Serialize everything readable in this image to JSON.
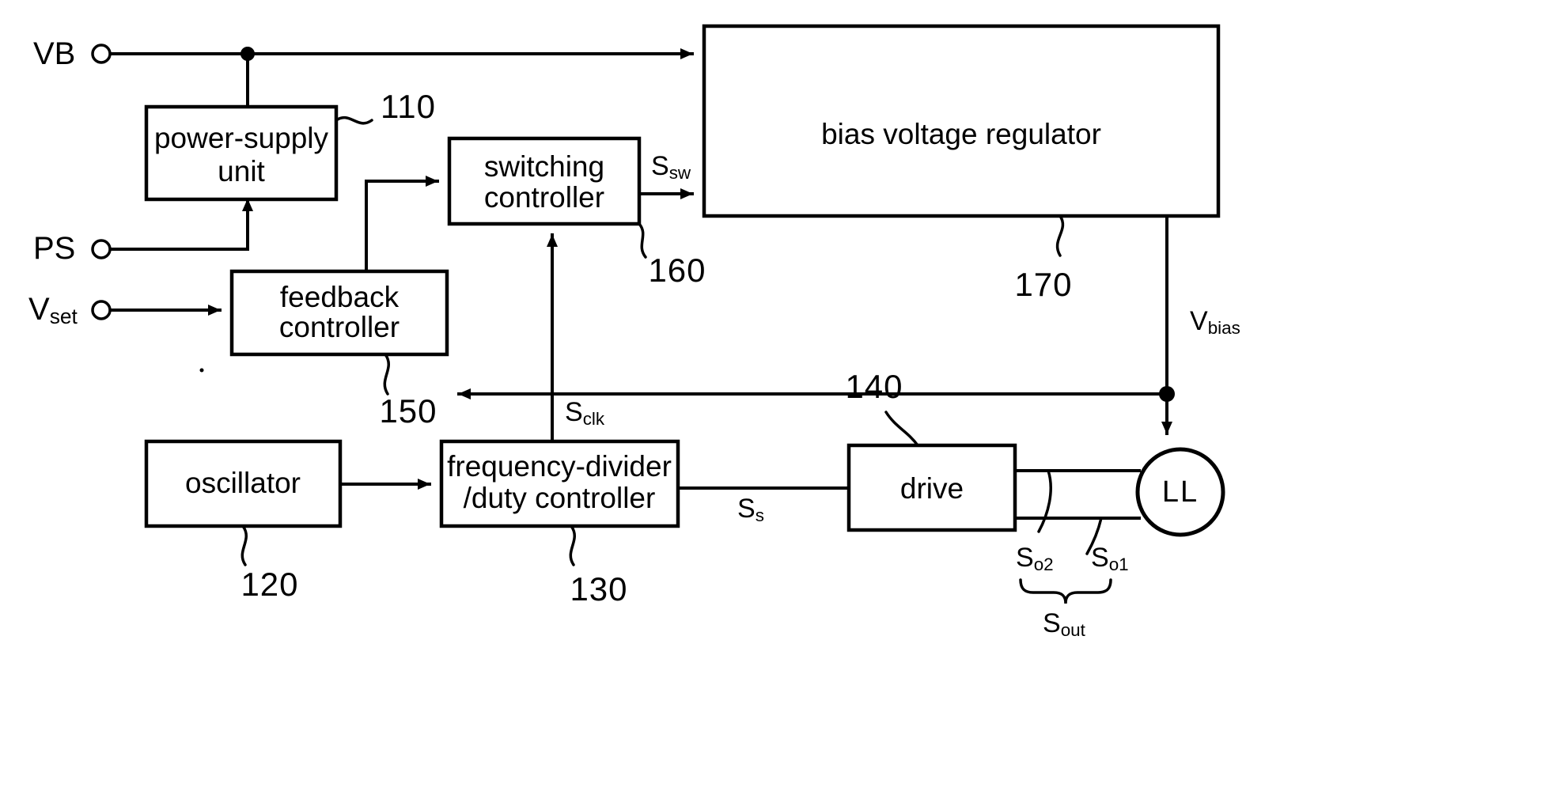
{
  "figure": {
    "type": "patent-block-diagram",
    "title": "lamp driving circuit block diagram",
    "background_color": "#ffffff",
    "line_color": "#000000"
  },
  "terminals": [
    {
      "id": "vb",
      "label": "VB",
      "base": "VB",
      "sub": ""
    },
    {
      "id": "ps",
      "label": "PS",
      "base": "PS",
      "sub": ""
    },
    {
      "id": "vset",
      "label": "Vset",
      "base": "V",
      "sub": "set"
    }
  ],
  "blocks": [
    {
      "id": "power-supply-unit",
      "lines": [
        "power-supply",
        "unit"
      ],
      "ref": "110"
    },
    {
      "id": "switching-controller",
      "lines": [
        "switching",
        "controller"
      ],
      "ref": "160"
    },
    {
      "id": "bias-voltage-regulator",
      "lines": [
        "bias voltage regulator"
      ],
      "ref": "170"
    },
    {
      "id": "feedback-controller",
      "lines": [
        "feedback",
        "controller"
      ],
      "ref": "150"
    },
    {
      "id": "oscillator",
      "lines": [
        "oscillator"
      ],
      "ref": "120"
    },
    {
      "id": "frequency-divider-duty-controller",
      "lines": [
        "frequency-divider",
        "/duty controller"
      ],
      "ref": "130"
    },
    {
      "id": "drive",
      "lines": [
        "drive"
      ],
      "ref": "140"
    }
  ],
  "lamp": {
    "id": "lamp",
    "label": "LL"
  },
  "signals": [
    {
      "id": "ssw",
      "base": "S",
      "sub": "sw"
    },
    {
      "id": "sclk",
      "base": "S",
      "sub": "clk"
    },
    {
      "id": "ss",
      "base": "S",
      "sub": "s"
    },
    {
      "id": "vbias",
      "base": "V",
      "sub": "bias"
    },
    {
      "id": "so2",
      "base": "S",
      "sub": "o2"
    },
    {
      "id": "so1",
      "base": "S",
      "sub": "o1"
    },
    {
      "id": "sout",
      "base": "S",
      "sub": "out"
    }
  ],
  "reference_numerals": [
    "110",
    "120",
    "130",
    "140",
    "150",
    "160",
    "170"
  ]
}
